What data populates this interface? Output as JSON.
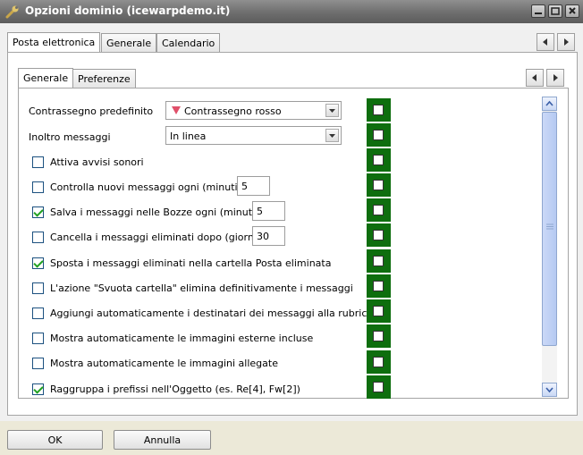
{
  "window": {
    "title": "Opzioni dominio (icewarpdemo.it)",
    "icon": "wrench-icon",
    "controls": [
      "minimize-icon",
      "maximize-icon",
      "close-icon"
    ]
  },
  "outer_tabs": [
    {
      "label": "Posta elettronica",
      "active": true
    },
    {
      "label": "Generale",
      "active": false
    },
    {
      "label": "Calendario",
      "active": false
    }
  ],
  "inner_tabs": [
    {
      "label": "Generale",
      "active": true
    },
    {
      "label": "Preferenze",
      "active": false
    }
  ],
  "settings": {
    "flag_label": "Contrassegno predefinito",
    "flag_value": "Contrassegno rosso",
    "flag_icon": "red-flag-icon",
    "forward_label": "Inoltro messaggi",
    "forward_value": "In linea",
    "options": [
      {
        "label": "Attiva avvisi sonori",
        "checked": false,
        "input": null
      },
      {
        "label": "Controlla nuovi messaggi ogni (minuti)",
        "checked": false,
        "input": "5"
      },
      {
        "label": "Salva i messaggi nelle Bozze ogni (minuti)",
        "checked": true,
        "input": "5"
      },
      {
        "label": "Cancella i messaggi eliminati dopo (giorni)",
        "checked": false,
        "input": "30"
      },
      {
        "label": "Sposta i messaggi eliminati nella cartella Posta eliminata",
        "checked": true,
        "input": null
      },
      {
        "label": "L'azione \"Svuota cartella\" elimina definitivamente i messaggi",
        "checked": false,
        "input": null
      },
      {
        "label": "Aggiungi automaticamente i destinatari dei messaggi alla rubrica",
        "checked": false,
        "input": null
      },
      {
        "label": "Mostra automaticamente le immagini esterne incluse",
        "checked": false,
        "input": null
      },
      {
        "label": "Mostra automaticamente le immagini allegate",
        "checked": false,
        "input": null
      },
      {
        "label": "Raggruppa i prefissi nell'Oggetto (es. Re[4], Fw[2])",
        "checked": true,
        "input": null
      }
    ]
  },
  "colors": {
    "lock_column": "#0e6e0e",
    "title_bar": "#6e6e6e",
    "check_mark": "#21a121"
  },
  "buttons": {
    "ok": "OK",
    "cancel": "Annulla"
  }
}
